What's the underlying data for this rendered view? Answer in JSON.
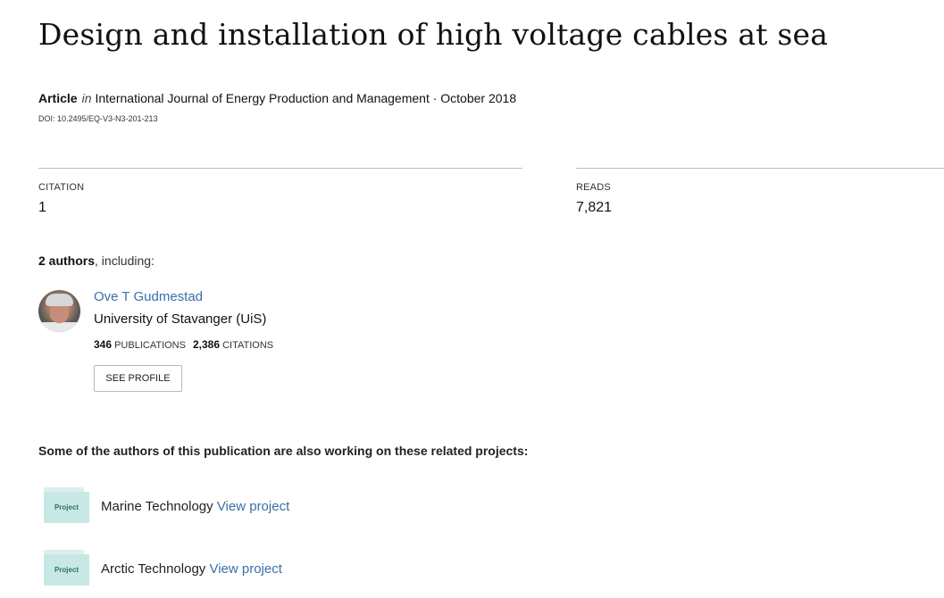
{
  "title": "Design and installation of high voltage cables at sea",
  "meta": {
    "type": "Article",
    "in": "in",
    "journal": "International Journal of Energy Production and Management · October 2018",
    "doi": "DOI: 10.2495/EQ-V3-N3-201-213"
  },
  "stats": {
    "citation_label": "CITATION",
    "citation_value": "1",
    "reads_label": "READS",
    "reads_value": "7,821"
  },
  "authors": {
    "count_text": "2 authors",
    "suffix": ", including:",
    "list": [
      {
        "name": "Ove T Gudmestad",
        "affiliation": "University of Stavanger (UiS)",
        "publications_count": "346",
        "publications_label": "PUBLICATIONS",
        "citations_count": "2,386",
        "citations_label": "CITATIONS",
        "button": "SEE PROFILE"
      }
    ]
  },
  "projects": {
    "heading": "Some of the authors of this publication are also working on these related projects:",
    "items": [
      {
        "icon_label": "Project",
        "name": "Marine Technology",
        "link": "View project"
      },
      {
        "icon_label": "Project",
        "name": "Arctic Technology",
        "link": "View project"
      }
    ]
  },
  "colors": {
    "link": "#3a6fa8",
    "project_icon": "#c7e8e4",
    "rule": "#bdbdbd"
  }
}
